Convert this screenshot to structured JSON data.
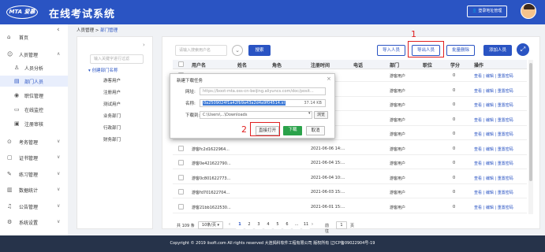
{
  "header": {
    "logo_text": "MTA 爱慕",
    "title": "在线考试系统",
    "logout_label": "登录地址管理",
    "brand_color": "#2a54c3"
  },
  "sidebar": {
    "collapse_icon": "chevron-left-icon",
    "items": [
      {
        "label": "首页",
        "icon": "home-icon",
        "glyph": "⌂"
      },
      {
        "label": "人员管理",
        "icon": "person-icon",
        "glyph": "☺",
        "caret": "∧"
      },
      {
        "label": "人员分析",
        "icon": "person-icon",
        "glyph": "♙",
        "sub": true
      },
      {
        "label": "部门人员",
        "icon": "org-icon",
        "glyph": "▤",
        "sub": true,
        "active": true
      },
      {
        "label": "职位管理",
        "icon": "badge-icon",
        "glyph": "◉",
        "sub": true
      },
      {
        "label": "在线监控",
        "icon": "monitor-icon",
        "glyph": "▭",
        "sub": true
      },
      {
        "label": "注册审核",
        "icon": "audit-icon",
        "glyph": "▣",
        "sub": true
      },
      {
        "label": "考务管理",
        "icon": "exam-icon",
        "glyph": "⊙",
        "caret": "∨"
      },
      {
        "label": "证书管理",
        "icon": "certificate-icon",
        "glyph": "▢",
        "caret": "∨"
      },
      {
        "label": "练习管理",
        "icon": "practice-icon",
        "glyph": "✎",
        "caret": "∨"
      },
      {
        "label": "数据统计",
        "icon": "chart-icon",
        "glyph": "▥",
        "caret": "∨"
      },
      {
        "label": "公告管理",
        "icon": "notice-icon",
        "glyph": "♫",
        "caret": "∨"
      },
      {
        "label": "系统设置",
        "icon": "gear-icon",
        "glyph": "⚙",
        "caret": "∨"
      }
    ]
  },
  "breadcrumb": {
    "parent": "人员管理",
    "separator": ">",
    "current": "部门管理"
  },
  "tree": {
    "search_placeholder": "输入关键字进行过滤",
    "root": "▾ 创建部门名称",
    "nodes": [
      "游客用户",
      "注册用户",
      "测试用户",
      "业务部门",
      "行政部门",
      "财务部门"
    ]
  },
  "toolbar": {
    "search_placeholder": "请输入搜索用户名",
    "search_label": "搜索",
    "import_label": "导入人员",
    "export_label": "导出人员",
    "batch_delete_label": "批量删除",
    "add_label": "添加人员"
  },
  "table": {
    "columns": [
      "用户名",
      "姓名",
      "角色",
      "注册时间",
      "电话",
      "部门",
      "职位",
      "学分",
      "操作"
    ],
    "rows": [
      {
        "username": "",
        "name": "",
        "role": "",
        "time": "",
        "phone": "",
        "dept": "游客用户",
        "pos": "",
        "credit": "0"
      },
      {
        "username": "",
        "name": "",
        "role": "",
        "time": "",
        "phone": "",
        "dept": "游客用户",
        "pos": "",
        "credit": "0"
      },
      {
        "username": "",
        "name": "",
        "role": "",
        "time": "",
        "phone": "",
        "dept": "游客用户",
        "pos": "",
        "credit": "0"
      },
      {
        "username": "",
        "name": "",
        "role": "",
        "time": "",
        "phone": "",
        "dept": "游客用户",
        "pos": "",
        "credit": "0"
      },
      {
        "username": "",
        "name": "",
        "role": "",
        "time": "",
        "phone": "",
        "dept": "游客用户",
        "pos": "",
        "credit": "0"
      },
      {
        "username": "游客fc2d1622964...",
        "name": "",
        "role": "",
        "time": "2021-06-06 14:...",
        "phone": "",
        "dept": "游客用户",
        "pos": "",
        "credit": "0"
      },
      {
        "username": "游客0e421622790...",
        "name": "",
        "role": "",
        "time": "2021-06-04 15:...",
        "phone": "",
        "dept": "游客用户",
        "pos": "",
        "credit": "0"
      },
      {
        "username": "游客0c801622773...",
        "name": "",
        "role": "",
        "time": "2021-06-04 10:...",
        "phone": "",
        "dept": "游客用户",
        "pos": "",
        "credit": "0"
      },
      {
        "username": "游客fd701622704...",
        "name": "",
        "role": "",
        "time": "2021-06-03 15:...",
        "phone": "",
        "dept": "游客用户",
        "pos": "",
        "credit": "0"
      },
      {
        "username": "游客21bb1622530...",
        "name": "",
        "role": "",
        "time": "2021-06-01 15:...",
        "phone": "",
        "dept": "游客用户",
        "pos": "",
        "credit": "0"
      }
    ],
    "actions": "查看 | 编辑 | 重置密码"
  },
  "pagination": {
    "total": "共 109 条",
    "page_size": "10条/页",
    "pages": [
      "1",
      "2",
      "3",
      "4",
      "5",
      "6",
      "...",
      "11"
    ],
    "current_page": "1",
    "goto_label": "前往",
    "goto_value": "1",
    "page_unit": "页"
  },
  "dialog": {
    "title": "新建下载任务",
    "url_label": "网址:",
    "url_value": "https://boot-mta.oss-cn-beijing.aliyuncs.com/doc/posit...",
    "name_label": "名称:",
    "name_value": "0a2509024f1a42fb9a43a2d4a9f04514.xl",
    "size": "37.14 KB",
    "path_label": "下载到:",
    "path_value": "C:\\Users\\...\\Downloads",
    "browse_label": "浏览",
    "open_label": "直接打开",
    "download_label": "下载",
    "cancel_label": "取消"
  },
  "annotations": {
    "marker_1": "1",
    "marker_2": "2"
  },
  "footer": {
    "text": "Copyright © 2019 iisoft.com All rights reserved 大连揭科软件工程有限公司 版权所有 辽ICP备09022904号-19"
  }
}
